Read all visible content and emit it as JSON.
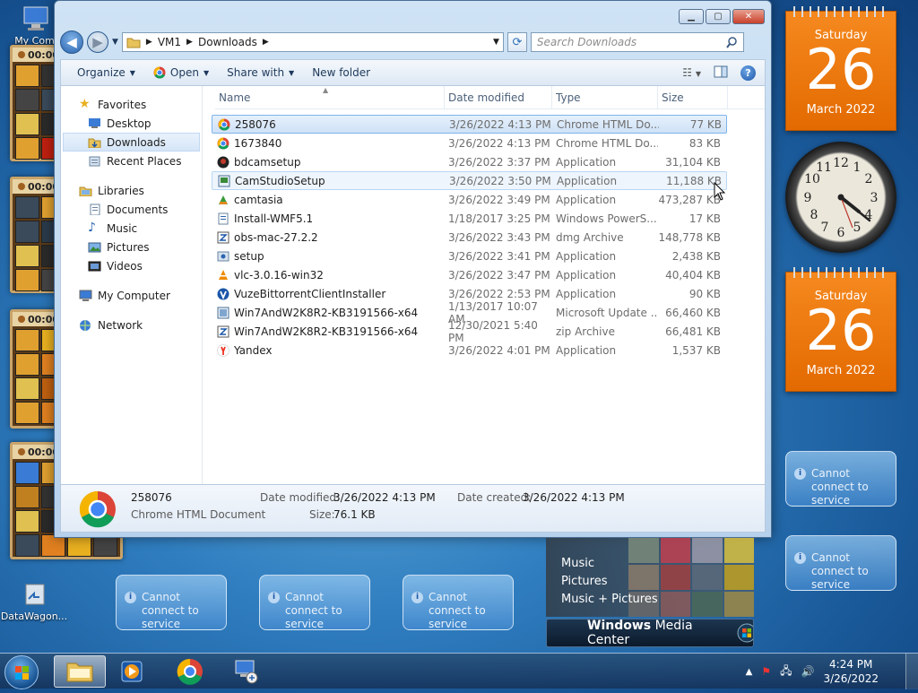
{
  "desktop": {
    "icons": [
      {
        "label": "My Comp"
      },
      {
        "label": "DataWagon..."
      }
    ],
    "tile_gadget_timer": "00:00"
  },
  "window": {
    "breadcrumb": [
      "VM1",
      "Downloads"
    ],
    "search_placeholder": "Search Downloads",
    "toolbar": {
      "organize": "Organize",
      "open": "Open",
      "share_with": "Share with",
      "new_folder": "New folder"
    },
    "nav": {
      "favorites": "Favorites",
      "favorites_items": [
        "Desktop",
        "Downloads",
        "Recent Places"
      ],
      "libraries": "Libraries",
      "libraries_items": [
        "Documents",
        "Music",
        "Pictures",
        "Videos"
      ],
      "my_computer": "My Computer",
      "network": "Network"
    },
    "columns": {
      "name": "Name",
      "date": "Date modified",
      "type": "Type",
      "size": "Size"
    },
    "files": [
      {
        "name": "258076",
        "date": "3/26/2022 4:13 PM",
        "type": "Chrome HTML Do...",
        "size": "77 KB",
        "icon": "chrome-icon"
      },
      {
        "name": "1673840",
        "date": "3/26/2022 4:13 PM",
        "type": "Chrome HTML Do...",
        "size": "83 KB",
        "icon": "chrome-icon"
      },
      {
        "name": "bdcamsetup",
        "date": "3/26/2022 3:37 PM",
        "type": "Application",
        "size": "31,104 KB",
        "icon": "bandicam-icon"
      },
      {
        "name": "CamStudioSetup",
        "date": "3/26/2022 3:50 PM",
        "type": "Application",
        "size": "11,188 KB",
        "icon": "installer-icon"
      },
      {
        "name": "camtasia",
        "date": "3/26/2022 3:49 PM",
        "type": "Application",
        "size": "473,287 KB",
        "icon": "camtasia-icon"
      },
      {
        "name": "Install-WMF5.1",
        "date": "1/18/2017 3:25 PM",
        "type": "Windows PowerS...",
        "size": "17 KB",
        "icon": "script-icon"
      },
      {
        "name": "obs-mac-27.2.2",
        "date": "3/26/2022 3:43 PM",
        "type": "dmg Archive",
        "size": "148,778 KB",
        "icon": "archive-icon"
      },
      {
        "name": "setup",
        "date": "3/26/2022 3:41 PM",
        "type": "Application",
        "size": "2,438 KB",
        "icon": "setup-icon"
      },
      {
        "name": "vlc-3.0.16-win32",
        "date": "3/26/2022 3:47 PM",
        "type": "Application",
        "size": "40,404 KB",
        "icon": "vlc-icon"
      },
      {
        "name": "VuzeBittorrentClientInstaller",
        "date": "3/26/2022 2:53 PM",
        "type": "Application",
        "size": "90 KB",
        "icon": "vuze-icon"
      },
      {
        "name": "Win7AndW2K8R2-KB3191566-x64",
        "date": "1/13/2017 10:07 AM",
        "type": "Microsoft Update ...",
        "size": "66,460 KB",
        "icon": "update-icon"
      },
      {
        "name": "Win7AndW2K8R2-KB3191566-x64",
        "date": "12/30/2021 5:40 PM",
        "type": "zip Archive",
        "size": "66,481 KB",
        "icon": "archive-icon"
      },
      {
        "name": "Yandex",
        "date": "3/26/2022 4:01 PM",
        "type": "Application",
        "size": "1,537 KB",
        "icon": "yandex-icon"
      }
    ],
    "details": {
      "name": "258076",
      "type": "Chrome HTML Document",
      "modified_label": "Date modified:",
      "modified": "3/26/2022 4:13 PM",
      "created_label": "Date created:",
      "created": "3/26/2022 4:13 PM",
      "size_label": "Size:",
      "size": "76.1 KB"
    }
  },
  "gadgets": {
    "calendar": {
      "day": "Saturday",
      "date": "26",
      "month": "March 2022"
    },
    "service_msg": "Cannot connect to service",
    "media_center": {
      "items": [
        "Music",
        "Pictures",
        "Music + Pictures"
      ],
      "brand_strong": "Windows",
      "brand_rest": "Media Center"
    }
  },
  "taskbar": {
    "time": "4:24 PM",
    "date": "3/26/2022"
  }
}
